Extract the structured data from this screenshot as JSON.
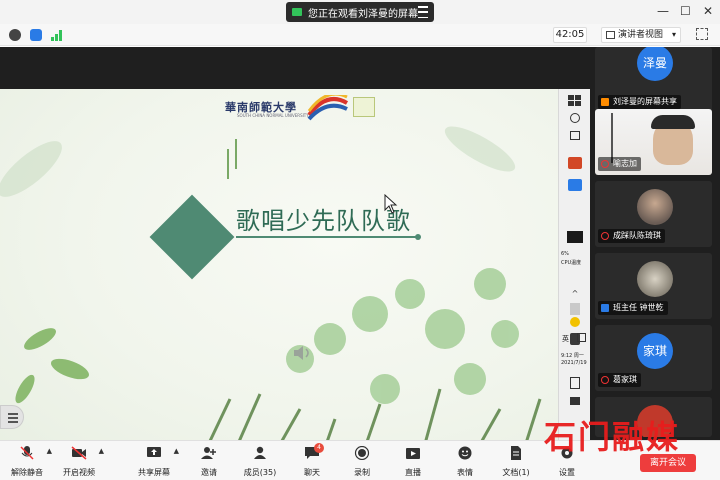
{
  "titlebar": {
    "share_notice": "您正在观看刘泽曼的屏幕",
    "minimize": "—",
    "maximize": "☐",
    "close": "✕"
  },
  "toolbar": {
    "timer": "42:05",
    "view_mode": "演讲者视图"
  },
  "slide": {
    "school_name": "華南師範大學",
    "school_name_en": "SOUTH CHINA NORMAL UNIVERSITY",
    "title": "歌唱少先队队歌"
  },
  "taskbar": {
    "cpu_percent": "6%",
    "cpu_label": "CPU温度",
    "ime_label": "英",
    "time": "9:12 周一",
    "date": "2021/7/19"
  },
  "participants": [
    {
      "name": "刘泽曼的屏幕共享",
      "avatar_text": "泽曼",
      "type": "avatar",
      "host": true
    },
    {
      "name": "喻志加",
      "type": "video",
      "host": false
    },
    {
      "name": "成踩队陈琦琪",
      "type": "photo",
      "host": false
    },
    {
      "name": "班主任 钟世乾",
      "type": "photo",
      "host": true
    },
    {
      "name": "葛家琪",
      "avatar_text": "家琪",
      "type": "avatar",
      "host": false
    }
  ],
  "controls": {
    "unmute": "解除静音",
    "start_video": "开启视频",
    "share_screen": "共享屏幕",
    "invite": "邀请",
    "participants": "成员(35)",
    "chat": "聊天",
    "chat_badge": "4",
    "record": "录制",
    "live": "直播",
    "reactions": "表情",
    "docs": "文档(1)",
    "settings": "设置",
    "leave": "离开会议"
  },
  "watermark": {
    "text": "石门融媒"
  },
  "colors": {
    "accent_blue": "#2a7be6",
    "slide_green": "#4f8a73",
    "leave_red": "#ee3d3d",
    "watermark_red": "#e81d1d"
  }
}
